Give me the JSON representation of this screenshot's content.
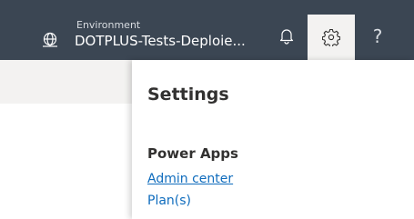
{
  "header": {
    "environment_label": "Environment",
    "environment_name": "DOTPLUS-Tests-Deploie...",
    "help_glyph": "?",
    "icons": {
      "environment": "globe-icon",
      "notifications": "bell-icon",
      "settings": "gear-icon",
      "help": "help-icon"
    },
    "colors": {
      "background": "#3b4653",
      "active_button": "#f3f2f1"
    }
  },
  "settings_panel": {
    "title": "Settings",
    "sections": [
      {
        "title": "Power Apps",
        "links": [
          {
            "label": "Admin center"
          },
          {
            "label": "Plan(s)"
          }
        ]
      }
    ],
    "colors": {
      "link": "#0f6cbd"
    }
  }
}
